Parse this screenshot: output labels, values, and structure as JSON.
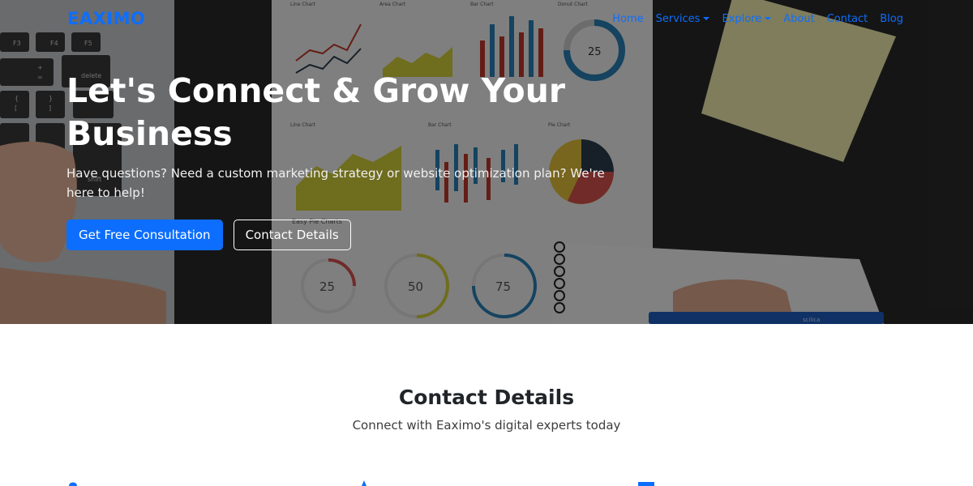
{
  "navbar": {
    "brand": "EAXIMO",
    "links": [
      {
        "label": "Home",
        "dropdown": false
      },
      {
        "label": "Services",
        "dropdown": true
      },
      {
        "label": "Explore",
        "dropdown": true
      },
      {
        "label": "About",
        "dropdown": false
      },
      {
        "label": "Contact",
        "dropdown": false
      },
      {
        "label": "Blog",
        "dropdown": false
      }
    ]
  },
  "hero": {
    "title_line1": "Let's Connect & Grow Your",
    "title_line2": "Business",
    "subtitle": "Have questions? Need a custom marketing strategy or website optimization plan? We're here to help!",
    "primary_button": "Get Free Consultation",
    "secondary_button": "Contact Details",
    "background": {
      "keyboard_keys": [
        "F3",
        "F4",
        "F5",
        "delete",
        "+",
        "=",
        "{",
        "[",
        "}",
        "]",
        "shift"
      ],
      "report_labels": [
        "Line Chart",
        "Area Chart",
        "Bar Chart",
        "Donut Chart",
        "Line Chart",
        "Bar Chart",
        "Pie Chart",
        "Easy Pie Charts"
      ],
      "donut_value": "25",
      "donut_label": "Donut Chart",
      "pie_values": [
        "25",
        "50",
        "75"
      ],
      "pencil_text": "scilica"
    }
  },
  "contact": {
    "title": "Contact Details",
    "subtitle": "Connect with Eaximo's digital experts today"
  },
  "colors": {
    "accent": "#0d6efd",
    "hero_overlay": "rgba(0,0,0,0.48)",
    "hero_text": "#ffffff",
    "heading_dark": "#212529"
  },
  "icons": [
    "map-marker-icon",
    "phone-icon",
    "envelope-icon"
  ]
}
